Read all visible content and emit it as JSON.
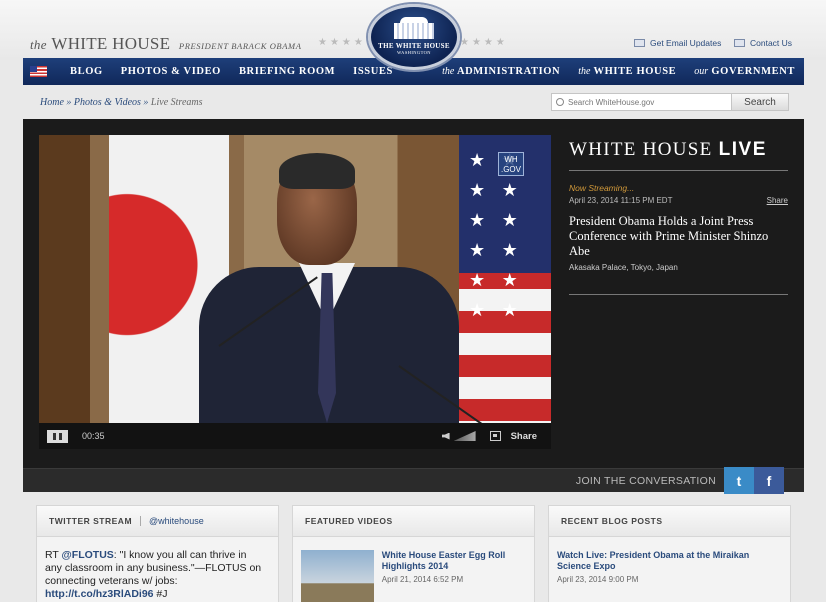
{
  "header": {
    "brand_the": "the",
    "brand_name": "WHITE HOUSE",
    "brand_president": "PRESIDENT BARACK OBAMA",
    "seal_line1": "THE WHITE HOUSE",
    "seal_line2": "WASHINGTON",
    "email_updates": "Get Email Updates",
    "contact_us": "Contact Us"
  },
  "nav": {
    "items": [
      {
        "label": "BLOG"
      },
      {
        "label": "PHOTOS & VIDEO"
      },
      {
        "label": "BRIEFING ROOM"
      },
      {
        "label": "ISSUES"
      }
    ],
    "right_items": [
      {
        "pre": "the",
        "label": "ADMINISTRATION"
      },
      {
        "pre": "the",
        "label": "WHITE HOUSE"
      },
      {
        "pre": "our",
        "label": "GOVERNMENT"
      }
    ]
  },
  "breadcrumb": {
    "home": "Home",
    "photos_video": "Photos & Videos",
    "current": "Live Streams",
    "separator": "»"
  },
  "search": {
    "placeholder": "Search WhiteHouse.gov",
    "button": "Search"
  },
  "player": {
    "badge": "WH .GOV",
    "time": "00:35",
    "share": "Share"
  },
  "live": {
    "title_main": "WHITE HOUSE",
    "title_bold": "LIVE",
    "now_streaming": "Now Streaming...",
    "datetime": "April 23, 2014 11:15 PM EDT",
    "share": "Share",
    "headline": "President Obama Holds a Joint Press Conference with Prime Minister Shinzo Abe",
    "location": "Akasaka Palace, Tokyo, Japan"
  },
  "join": {
    "text": "JOIN THE CONVERSATION",
    "twitter_glyph": "t",
    "facebook_glyph": "f"
  },
  "twitter": {
    "heading": "TWITTER STREAM",
    "handle": "@whitehouse",
    "tweet_prefix": "RT ",
    "tweet_mention": "@FLOTUS",
    "tweet_text": ": \"I know you all can thrive in any classroom in any business.\"—FLOTUS on connecting veterans w/ jobs: ",
    "tweet_link": "http://t.co/hz3RlADi96",
    "tweet_tail": " #J"
  },
  "featured_videos": {
    "heading": "FEATURED VIDEOS",
    "items": [
      {
        "title": "White House Easter Egg Roll Highlights 2014",
        "date": "April 21, 2014 6:52 PM"
      }
    ]
  },
  "blog_posts": {
    "heading": "RECENT BLOG POSTS",
    "items": [
      {
        "title": "Watch Live: President Obama at the Miraikan Science Expo",
        "date": "April 23, 2014 9:00 PM"
      }
    ]
  }
}
